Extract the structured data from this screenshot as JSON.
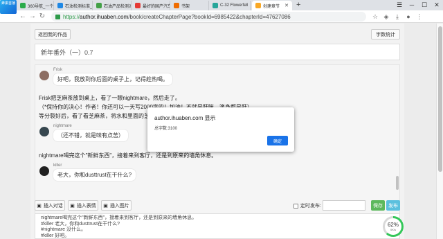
{
  "browser": {
    "badge": "蜂巢首播",
    "tabs": [
      {
        "title": "360导航_一个主",
        "color": "#2bab4a",
        "active": false
      },
      {
        "title": "石油检测标准_",
        "color": "#1e88e5",
        "active": false
      },
      {
        "title": "石油产品检测对",
        "color": "#43a047",
        "active": false
      },
      {
        "title": "最好的国产汽车",
        "color": "#e53935",
        "active": false
      },
      {
        "title": "书架",
        "color": "#ef6c00",
        "active": false
      },
      {
        "title": "C-32 Flowerfell",
        "color": "#26a69a",
        "active": false
      },
      {
        "title": "创建章节",
        "color": "#f9a825",
        "active": true
      }
    ],
    "new_tab": "+",
    "url_domain": "author.ihuaben.com",
    "url_path": "/book/createChapterPage?bookId=6985422&chapterId=47627086",
    "url_prefix": "https://"
  },
  "page": {
    "back_button": "返回我的作品",
    "word_count_button": "字数统计",
    "chapter_title": "新年番外（一）0.7",
    "messages": [
      {
        "sender": "Frisk",
        "text": "好吧，我放到你后面的桌子上，记得趁热喝。",
        "avatar_color": "#8d6e63"
      },
      {
        "sender": "nightmare",
        "text": "（还不错，就是味有点苦）",
        "avatar_color": "#37474f"
      },
      {
        "sender": "killer",
        "text": "老大，你和dusttrust在干什么?",
        "avatar_color": "#212121"
      }
    ],
    "narration": [
      "Frisk把芝麻茶放到桌上，看了一眼nightmare，然后走了。",
      "（*保持你的决心！作者！你还可以一天写2000字的！加油！不就是肝嘛，滴身都是肝）",
      "等分裂好后，看了看芝麻茶，将水和里面的芝麻",
      "nightmare喝完这个\"新鲜东西\"，接着来到客厅，还是到原来的墙角休息。"
    ],
    "toolbar": {
      "insert_dialogue": "插入对话",
      "insert_emoji": "插入表情",
      "insert_image": "插入图片",
      "schedule_label": "定时发布:",
      "schedule_placeholder": "",
      "save": "保存",
      "publish": "发布"
    },
    "source_lines": [
      "nightmare喝完这个\"新鲜东西\"，接着来到客厅，还是到原来的墙角休息。",
      "#killer 老大，你和dusttrust在干什么?",
      "#nightmare 没什么。",
      "#killer 好吧。"
    ]
  },
  "dialog": {
    "title": "author.ihuaben.com 显示",
    "message": "总字数:3100",
    "ok": "确定"
  },
  "speed_widget": {
    "percent": "62%",
    "speed": "0K/s",
    "fraction": 0.62
  },
  "colors": {
    "accent_blue": "#1a73e8",
    "save_green": "#5cb85c",
    "publish_teal": "#5bc0de"
  }
}
